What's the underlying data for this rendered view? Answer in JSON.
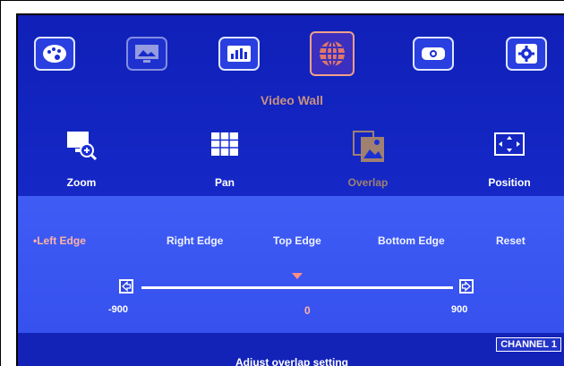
{
  "top_menu": {
    "icons": [
      "palette-icon",
      "picture-icon",
      "equalizer-icon",
      "globe-icon",
      "projector-icon",
      "gear-icon"
    ],
    "selected": "globe-icon",
    "title": "Video Wall"
  },
  "submenu": {
    "items": [
      {
        "label": "Zoom",
        "icon": "zoom-monitor-icon"
      },
      {
        "label": "Pan",
        "icon": "grid-icon"
      },
      {
        "label": "Overlap",
        "icon": "overlap-picture-icon"
      },
      {
        "label": "Position",
        "icon": "position-arrows-icon"
      }
    ],
    "active": "Overlap"
  },
  "overlap": {
    "edges": [
      "•Left Edge",
      "Right Edge",
      "Top Edge",
      "Bottom Edge",
      "Reset"
    ],
    "selected_edge": "•Left Edge",
    "min": "-900",
    "max": "900",
    "value": "0",
    "value_fraction": 0.5
  },
  "footer": {
    "channel": "CHANNEL 1",
    "hint": "Adjust overlap setting"
  },
  "colors": {
    "background": "#1a2fd4",
    "panel": "#3f5cf5",
    "selected_text": "#ffb2a6",
    "title": "#c89080"
  }
}
